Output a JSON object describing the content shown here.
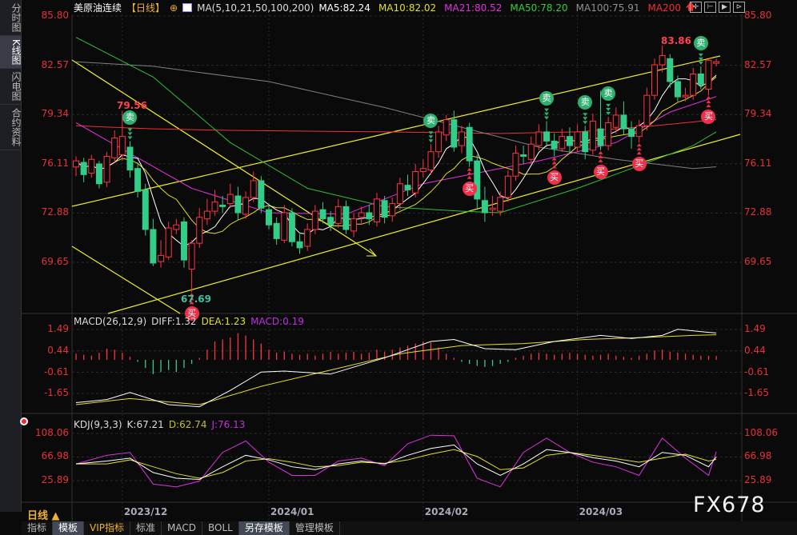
{
  "sidebar": {
    "tabs": [
      "分时图",
      "K线图",
      "闪电图",
      "合约资料"
    ],
    "active": 1
  },
  "header": {
    "title": "美原油连续",
    "period": "【日线】",
    "ma_label": "MA(5,10,21,50,100,200)",
    "ma": [
      {
        "label": "MA5:82.24",
        "color": "#ffffff"
      },
      {
        "label": "MA10:82.02",
        "color": "#e0e020"
      },
      {
        "label": "MA21:80.52",
        "color": "#e030e0"
      },
      {
        "label": "MA50:78.20",
        "color": "#30d030"
      },
      {
        "label": "MA100:75.91",
        "color": "#909090"
      },
      {
        "label": "MA200",
        "color": "#f03030"
      }
    ]
  },
  "toolbar": [
    "✛",
    "⊢",
    "▶",
    "⊳"
  ],
  "price_axis": {
    "ticks": [
      "85.80",
      "82.57",
      "79.34",
      "76.11",
      "72.88",
      "69.65"
    ],
    "values": [
      85.8,
      82.57,
      79.34,
      76.11,
      72.88,
      69.65
    ]
  },
  "annotations": {
    "high1": "79.56",
    "low1": "67.69",
    "high2": "83.86"
  },
  "chart_data": {
    "type": "candlestick",
    "ohlc": [
      [
        75.9,
        76.6,
        75.3,
        76.3
      ],
      [
        76.2,
        76.5,
        74.9,
        75.4
      ],
      [
        75.5,
        76.7,
        75.2,
        76.4
      ],
      [
        76.1,
        76.3,
        74.5,
        74.8
      ],
      [
        74.9,
        76.9,
        74.6,
        76.6
      ],
      [
        76.5,
        78.3,
        76.2,
        77.8
      ],
      [
        76.7,
        79.56,
        76.3,
        77.9
      ],
      [
        77.2,
        77.6,
        75.2,
        75.7
      ],
      [
        75.8,
        76.2,
        73.9,
        74.3
      ],
      [
        74.4,
        74.8,
        71.4,
        71.8
      ],
      [
        71.8,
        72.5,
        69.4,
        69.6
      ],
      [
        69.7,
        71.1,
        69.3,
        70.1
      ],
      [
        70.0,
        72.3,
        69.8,
        71.9
      ],
      [
        71.8,
        72.5,
        71.5,
        72.1
      ],
      [
        72.3,
        72.6,
        69.3,
        69.8
      ],
      [
        69.2,
        71.1,
        67.69,
        70.9
      ],
      [
        70.9,
        73.2,
        70.6,
        72.6
      ],
      [
        72.5,
        73.8,
        72.1,
        73.0
      ],
      [
        73.0,
        74.4,
        72.7,
        73.6
      ],
      [
        73.4,
        74.0,
        72.9,
        73.3
      ],
      [
        73.5,
        74.8,
        73.2,
        74.1
      ],
      [
        74.0,
        74.6,
        72.4,
        72.9
      ],
      [
        72.8,
        74.3,
        72.5,
        73.9
      ],
      [
        73.9,
        75.6,
        73.6,
        75.0
      ],
      [
        75.0,
        75.3,
        72.9,
        73.2
      ],
      [
        73.1,
        73.5,
        71.8,
        72.1
      ],
      [
        72.2,
        72.6,
        70.8,
        71.2
      ],
      [
        71.1,
        73.4,
        70.9,
        72.9
      ],
      [
        72.9,
        73.2,
        70.7,
        71.0
      ],
      [
        71.0,
        71.5,
        70.2,
        70.6
      ],
      [
        70.7,
        72.2,
        70.4,
        71.8
      ],
      [
        71.8,
        73.4,
        71.5,
        73.0
      ],
      [
        73.1,
        73.6,
        72.2,
        72.5
      ],
      [
        72.6,
        73.0,
        71.7,
        72.1
      ],
      [
        72.2,
        73.8,
        71.9,
        73.3
      ],
      [
        73.3,
        73.7,
        71.5,
        71.8
      ],
      [
        71.7,
        72.9,
        71.3,
        72.5
      ],
      [
        72.6,
        73.3,
        72.2,
        72.9
      ],
      [
        72.9,
        73.4,
        72.1,
        72.5
      ],
      [
        72.3,
        74.2,
        72.0,
        73.8
      ],
      [
        73.7,
        74.0,
        72.2,
        72.6
      ],
      [
        72.7,
        73.9,
        72.3,
        73.5
      ],
      [
        73.5,
        75.2,
        73.1,
        74.8
      ],
      [
        74.7,
        75.4,
        74.0,
        74.4
      ],
      [
        74.2,
        76.1,
        73.9,
        75.6
      ],
      [
        75.6,
        76.4,
        75.2,
        75.8
      ],
      [
        75.7,
        77.4,
        75.4,
        76.9
      ],
      [
        76.9,
        78.6,
        76.5,
        78.2
      ],
      [
        78.0,
        79.3,
        77.6,
        79.0
      ],
      [
        79.0,
        79.6,
        76.9,
        77.2
      ],
      [
        77.3,
        78.6,
        76.8,
        78.2
      ],
      [
        78.5,
        78.8,
        75.9,
        76.3
      ],
      [
        76.3,
        76.7,
        73.2,
        73.8
      ],
      [
        73.7,
        74.6,
        72.3,
        72.9
      ],
      [
        73.1,
        74.0,
        72.7,
        73.2
      ],
      [
        73.0,
        74.3,
        72.7,
        73.9
      ],
      [
        73.9,
        75.7,
        73.6,
        75.3
      ],
      [
        75.3,
        77.3,
        75.0,
        76.8
      ],
      [
        76.7,
        77.3,
        76.1,
        76.6
      ],
      [
        76.4,
        77.9,
        76.1,
        77.4
      ],
      [
        77.3,
        78.7,
        77.0,
        78.2
      ],
      [
        78.2,
        78.9,
        77.2,
        77.6
      ],
      [
        77.6,
        78.1,
        76.6,
        77.1
      ],
      [
        77.1,
        78.4,
        76.9,
        77.9
      ],
      [
        77.9,
        78.5,
        76.8,
        77.3
      ],
      [
        77.2,
        78.7,
        76.9,
        78.2
      ],
      [
        78.2,
        78.6,
        76.4,
        76.9
      ],
      [
        77.0,
        79.4,
        76.7,
        78.9
      ],
      [
        78.4,
        80.9,
        77.0,
        77.3
      ],
      [
        77.3,
        79.2,
        77.0,
        78.8
      ],
      [
        78.5,
        79.8,
        78.1,
        79.3
      ],
      [
        79.3,
        80.2,
        78.0,
        78.4
      ],
      [
        78.4,
        78.9,
        77.1,
        77.9
      ],
      [
        77.9,
        79.0,
        77.5,
        78.6
      ],
      [
        78.6,
        81.1,
        78.3,
        80.6
      ],
      [
        80.6,
        83.0,
        80.3,
        82.6
      ],
      [
        82.6,
        83.86,
        82.1,
        83.2
      ],
      [
        83.0,
        83.3,
        81.1,
        81.5
      ],
      [
        81.5,
        81.9,
        80.2,
        80.5
      ],
      [
        80.5,
        81.1,
        80.2,
        80.6
      ],
      [
        80.6,
        82.4,
        80.3,
        82.0
      ],
      [
        82.0,
        82.5,
        81.0,
        81.3
      ],
      [
        81.0,
        83.0,
        80.6,
        82.9
      ],
      [
        82.7,
        83.0,
        82.5,
        82.8
      ]
    ],
    "ma21": [
      [
        0,
        78.8
      ],
      [
        8,
        76.5
      ],
      [
        15,
        74.5
      ],
      [
        25,
        72.9
      ],
      [
        35,
        72.8
      ],
      [
        45,
        74.8
      ],
      [
        52,
        75.5
      ],
      [
        60,
        76.3
      ],
      [
        70,
        77.5
      ],
      [
        77,
        79.5
      ],
      [
        83,
        80.52
      ]
    ],
    "ma50": [
      [
        0,
        84.4
      ],
      [
        10,
        81.8
      ],
      [
        20,
        77.5
      ],
      [
        30,
        74.5
      ],
      [
        40,
        73.3
      ],
      [
        50,
        73.0
      ],
      [
        55,
        72.9
      ],
      [
        65,
        74.5
      ],
      [
        72,
        75.8
      ],
      [
        80,
        77.3
      ],
      [
        83,
        78.2
      ]
    ],
    "ma100": [
      [
        0,
        82.8
      ],
      [
        10,
        82.5
      ],
      [
        25,
        81.5
      ],
      [
        40,
        79.8
      ],
      [
        50,
        78.5
      ],
      [
        60,
        77.2
      ],
      [
        70,
        76.4
      ],
      [
        80,
        75.8
      ],
      [
        83,
        75.91
      ]
    ],
    "ma200": [
      [
        0,
        78.6
      ],
      [
        10,
        78.4
      ],
      [
        20,
        78.3
      ],
      [
        40,
        78.2
      ],
      [
        55,
        78.1
      ],
      [
        65,
        78.2
      ],
      [
        75,
        78.6
      ],
      [
        83,
        79.0
      ]
    ],
    "signals": [
      {
        "i": 7,
        "type": "sell",
        "label": "卖"
      },
      {
        "i": 15,
        "type": "buy",
        "label": "买"
      },
      {
        "i": 46,
        "type": "sell",
        "label": "卖"
      },
      {
        "i": 51,
        "type": "buy",
        "label": "买"
      },
      {
        "i": 61,
        "type": "sell",
        "label": "卖"
      },
      {
        "i": 62,
        "type": "buy",
        "label": "买"
      },
      {
        "i": 66,
        "type": "sell",
        "label": "卖"
      },
      {
        "i": 68,
        "type": "buy",
        "label": "买"
      },
      {
        "i": 69,
        "type": "sell",
        "label": "卖"
      },
      {
        "i": 73,
        "type": "buy",
        "label": "买"
      },
      {
        "i": 81,
        "type": "sell",
        "label": "卖"
      },
      {
        "i": 82,
        "type": "buy",
        "label": "买"
      }
    ],
    "x_ticks": [
      {
        "i": 6,
        "label": "2023/12"
      },
      {
        "i": 25,
        "label": "2024/01"
      },
      {
        "i": 45,
        "label": "2024/02"
      },
      {
        "i": 65,
        "label": "2024/03"
      }
    ],
    "macd": {
      "header": "MACD(26,12,9)",
      "diff_label": "DIFF:1.32",
      "dea_label": "DEA:1.23",
      "macd_label": "MACD:0.19",
      "ticks": [
        "1.49",
        "0.44",
        "-0.61",
        "-1.65"
      ],
      "values": [
        1.49,
        0.44,
        -0.61,
        -1.65
      ],
      "hist": [
        0.3,
        0.25,
        0.2,
        0.35,
        0.55,
        0.5,
        0.35,
        0.15,
        -0.1,
        -0.4,
        -0.7,
        -0.6,
        -0.5,
        -0.6,
        -0.4,
        -0.2,
        0.1,
        0.5,
        0.9,
        1.0,
        1.1,
        1.3,
        1.2,
        1.0,
        0.8,
        0.5,
        0.35,
        0.4,
        0.3,
        0.25,
        0.3,
        0.2,
        0.3,
        0.4,
        0.3,
        0.35,
        0.4,
        0.3,
        0.35,
        0.5,
        0.4,
        0.5,
        0.6,
        0.7,
        0.8,
        0.9,
        0.85,
        0.6,
        0.3,
        0.1,
        -0.1,
        -0.2,
        -0.3,
        -0.35,
        -0.3,
        -0.2,
        -0.1,
        0.1,
        0.2,
        0.3,
        0.35,
        0.3,
        0.25,
        0.3,
        0.35,
        0.3,
        0.25,
        0.2,
        0.25,
        0.3,
        0.2,
        0.15,
        0.1,
        0.2,
        0.3,
        0.45,
        0.5,
        0.4,
        0.35,
        0.3,
        0.25,
        0.2,
        0.2,
        0.19
      ],
      "diff": [
        [
          0,
          -2.1
        ],
        [
          4,
          -1.95
        ],
        [
          7,
          -1.6
        ],
        [
          12,
          -2.2
        ],
        [
          16,
          -2.3
        ],
        [
          20,
          -1.5
        ],
        [
          24,
          -0.6
        ],
        [
          27,
          -0.55
        ],
        [
          33,
          -0.7
        ],
        [
          40,
          0.1
        ],
        [
          46,
          0.9
        ],
        [
          49,
          1.0
        ],
        [
          53,
          0.55
        ],
        [
          57,
          0.5
        ],
        [
          62,
          0.9
        ],
        [
          68,
          1.2
        ],
        [
          72,
          1.05
        ],
        [
          76,
          1.2
        ],
        [
          78,
          1.5
        ],
        [
          82,
          1.35
        ],
        [
          83,
          1.32
        ]
      ],
      "dea": [
        [
          0,
          -2.2
        ],
        [
          7,
          -1.9
        ],
        [
          16,
          -2.2
        ],
        [
          24,
          -1.3
        ],
        [
          33,
          -0.5
        ],
        [
          42,
          0.3
        ],
        [
          50,
          0.7
        ],
        [
          58,
          0.8
        ],
        [
          66,
          1.0
        ],
        [
          74,
          1.1
        ],
        [
          80,
          1.2
        ],
        [
          83,
          1.23
        ]
      ]
    },
    "kdj": {
      "header": "KDJ(9,3,3)",
      "k_label": "K:67.21",
      "d_label": "D:62.74",
      "j_label": "J:76.13",
      "ticks": [
        "108.06",
        "66.98",
        "25.89"
      ],
      "values": [
        108.06,
        66.98,
        25.89
      ],
      "k": [
        [
          0,
          55
        ],
        [
          4,
          60
        ],
        [
          7,
          65
        ],
        [
          10,
          40
        ],
        [
          13,
          30
        ],
        [
          16,
          28
        ],
        [
          19,
          50
        ],
        [
          22,
          70
        ],
        [
          25,
          62
        ],
        [
          28,
          50
        ],
        [
          31,
          45
        ],
        [
          34,
          55
        ],
        [
          37,
          60
        ],
        [
          40,
          55
        ],
        [
          43,
          70
        ],
        [
          46,
          82
        ],
        [
          49,
          88
        ],
        [
          52,
          55
        ],
        [
          55,
          35
        ],
        [
          58,
          55
        ],
        [
          61,
          80
        ],
        [
          64,
          75
        ],
        [
          67,
          66
        ],
        [
          70,
          60
        ],
        [
          73,
          50
        ],
        [
          76,
          75
        ],
        [
          79,
          70
        ],
        [
          82,
          50
        ],
        [
          83,
          67.21
        ]
      ],
      "d": [
        [
          0,
          55
        ],
        [
          4,
          55
        ],
        [
          7,
          62
        ],
        [
          10,
          50
        ],
        [
          13,
          38
        ],
        [
          16,
          30
        ],
        [
          19,
          40
        ],
        [
          22,
          60
        ],
        [
          25,
          64
        ],
        [
          28,
          58
        ],
        [
          31,
          50
        ],
        [
          34,
          52
        ],
        [
          37,
          58
        ],
        [
          40,
          56
        ],
        [
          43,
          62
        ],
        [
          46,
          72
        ],
        [
          49,
          80
        ],
        [
          52,
          68
        ],
        [
          55,
          45
        ],
        [
          58,
          48
        ],
        [
          61,
          70
        ],
        [
          64,
          75
        ],
        [
          67,
          70
        ],
        [
          70,
          64
        ],
        [
          73,
          58
        ],
        [
          76,
          65
        ],
        [
          79,
          72
        ],
        [
          82,
          60
        ],
        [
          83,
          62.74
        ]
      ],
      "j": [
        [
          0,
          55
        ],
        [
          4,
          70
        ],
        [
          7,
          75
        ],
        [
          10,
          20
        ],
        [
          13,
          15
        ],
        [
          16,
          25
        ],
        [
          19,
          75
        ],
        [
          22,
          95
        ],
        [
          25,
          58
        ],
        [
          28,
          35
        ],
        [
          31,
          35
        ],
        [
          34,
          60
        ],
        [
          37,
          65
        ],
        [
          40,
          52
        ],
        [
          43,
          90
        ],
        [
          46,
          105
        ],
        [
          49,
          104
        ],
        [
          52,
          30
        ],
        [
          55,
          15
        ],
        [
          58,
          75
        ],
        [
          61,
          100
        ],
        [
          64,
          75
        ],
        [
          67,
          58
        ],
        [
          70,
          50
        ],
        [
          73,
          35
        ],
        [
          76,
          100
        ],
        [
          79,
          65
        ],
        [
          82,
          35
        ],
        [
          83,
          76.13
        ]
      ]
    }
  },
  "footer": {
    "period": "日线 ▲",
    "tabs": [
      "指标",
      "模板",
      "VIP指标",
      "标准",
      "MACD",
      "BOLL",
      "另存模板",
      "管理模板"
    ],
    "active": [
      1,
      6
    ]
  },
  "watermark": "FX678",
  "colors": {
    "up": "#ff3344",
    "down": "#33cc88",
    "axis_text": "#e8303a"
  }
}
